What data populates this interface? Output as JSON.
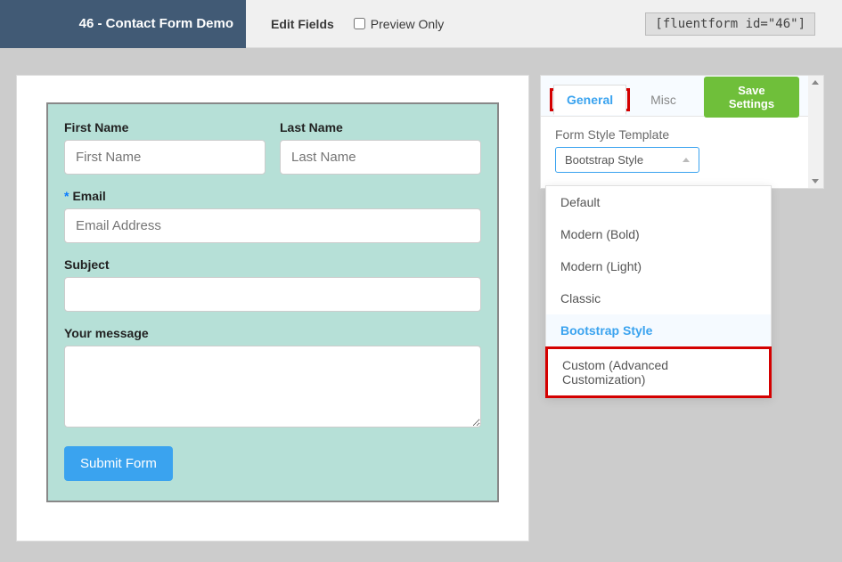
{
  "topbar": {
    "title": "46 - Contact Form Demo",
    "edit_fields": "Edit Fields",
    "preview_only_label": "Preview Only",
    "preview_only_checked": false,
    "shortcode": "[fluentform id=\"46\"]"
  },
  "form": {
    "first_name_label": "First Name",
    "first_name_placeholder": "First Name",
    "last_name_label": "Last Name",
    "last_name_placeholder": "Last Name",
    "email_label": "Email",
    "email_placeholder": "Email Address",
    "subject_label": "Subject",
    "message_label": "Your message",
    "submit_label": "Submit Form"
  },
  "settings": {
    "tabs": {
      "general": "General",
      "misc": "Misc"
    },
    "save_label": "Save Settings",
    "template_section_label": "Form Style Template",
    "template_selected": "Bootstrap Style",
    "template_options": [
      "Default",
      "Modern (Bold)",
      "Modern (Light)",
      "Classic",
      "Bootstrap Style",
      "Custom (Advanced Customization)"
    ]
  }
}
